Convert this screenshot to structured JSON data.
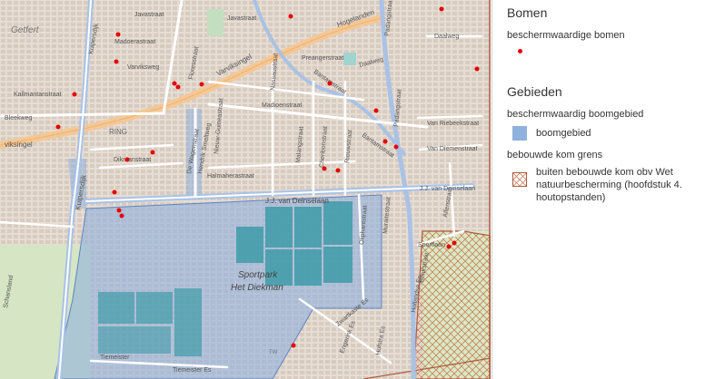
{
  "colors": {
    "tree_point": "#e60000",
    "boomgebied_fill": "#8fb1dd",
    "kom_hatch": "#c9825a",
    "kom_border": "#b05a3c"
  },
  "legend": {
    "section_trees": "Bomen",
    "trees_sub": "beschermwaardige bomen",
    "section_areas": "Gebieden",
    "areas_sub": "beschermwaardig boomgebied",
    "boomgebied_label": "boomgebied",
    "kom_sub": "bebouwde kom grens",
    "kom_label_1": "buiten bebouwde kom obv Wet",
    "kom_label_2": "natuurbescherming (hoofdstuk 4.",
    "kom_label_3": "houtopstanden)"
  },
  "map_labels": {
    "getfert": "Getfert",
    "javastraat": "Javastraat",
    "madoerastraat": "Madoerastraat",
    "varviksweg": "Varviksweg",
    "kallmantanstraat": "Kallmantanstraat",
    "bleekweg": "Bleekweg",
    "varviksingel": "Varviksingel",
    "viksingel": "viksingel",
    "ring": "RING",
    "floresstraat": "Floresstraat",
    "hogelanden": "Hogelanden",
    "padangstraat": "Padangstraat",
    "daalweg": "Daalweg",
    "preangerstraat": "Preangerstraat",
    "daalweg2": "Daalweg",
    "nassaustraat": "Nassaustraat",
    "madioenstraat": "Madioenstraat",
    "van_riebeekstraat": "Van Riebeekstraat",
    "van_diemenstraat": "Van Diemenstraat",
    "bantamstraat": "Bantamstraat",
    "niewe_guineastraat": "Nieuw-Guineastraat",
    "hendrik_smeltweg": "Hendrik Smeltweg",
    "de_wagenstraat": "De Wagenstraat",
    "malangstraat": "Malangstraat",
    "cheribonstraat": "Cheribonstraat",
    "riouwstraat": "Riouwstraat",
    "dikmanstraat": "Dikmanstraat",
    "halmaherastraat": "Halmaherastraat",
    "kuipersdijk": "Kuipersdijk",
    "kuipersdijk2": "Kuipersdijk",
    "jj_deinselaan": "J.J. van Deinselaan",
    "jj_deinselaan2": "J.J. van Deinselaan",
    "oliphant": "Oliphantstraat",
    "muraitestraat": "Muraitestraat",
    "alfenstraat": "Alfenstraat",
    "sportlaan": "Sportlaan",
    "brinkstraat": "Brinkstraat",
    "hollandse": "Hollandse Es",
    "sportpark_1": "Sportpark",
    "sportpark_2": "Het Diekman",
    "tiemeister": "Tiemeister",
    "tiemeister_es": "Tiemeister Es",
    "zwartkaste": "Zwartkaste Es",
    "engerink": "Engerink Es",
    "hofstra": "Hofstra Es",
    "schansland": "Schansland",
    "tw": "TW"
  }
}
